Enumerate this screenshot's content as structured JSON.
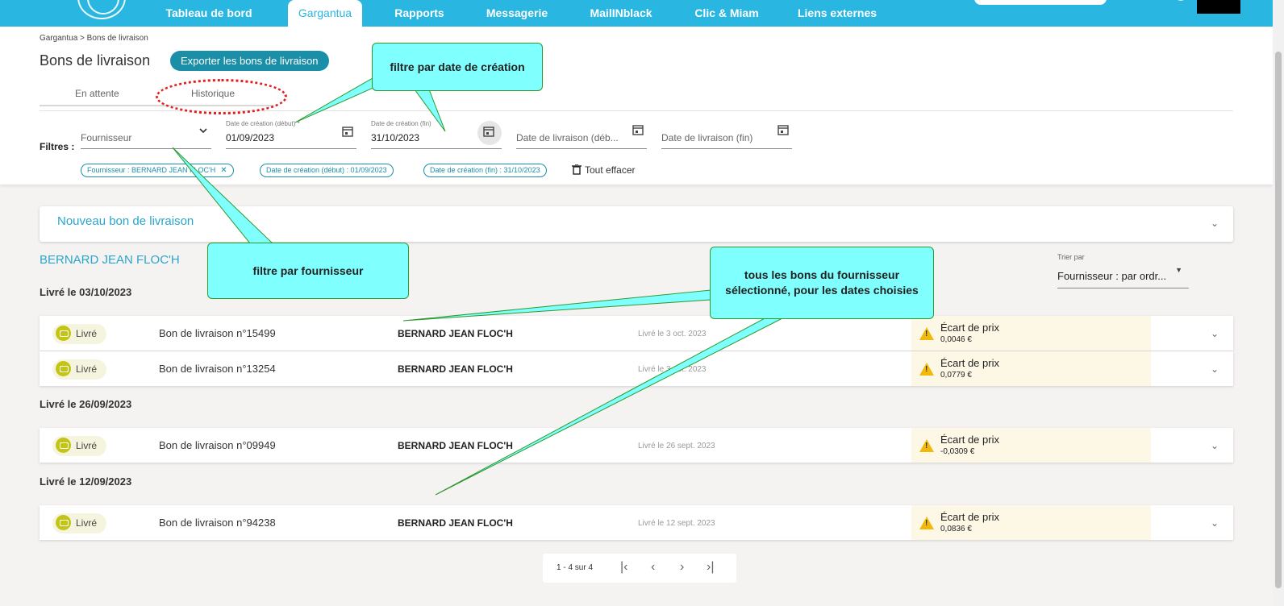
{
  "nav": {
    "items": [
      "Tableau de bord",
      "Gargantua",
      "Rapports",
      "Messagerie",
      "MailINblack",
      "Clic & Miam",
      "Liens externes"
    ],
    "active": "Gargantua"
  },
  "breadcrumb": "Gargantua > Bons de livraison",
  "page_title": "Bons de livraison",
  "export_label": "Exporter les bons de livraison",
  "tabs": [
    "En attente",
    "Historique"
  ],
  "filters": {
    "label": "Filtres :",
    "supplier_placeholder": "Fournisseur",
    "creation_start_label": "Date de création (début) *",
    "creation_start_value": "01/09/2023",
    "creation_end_label": "Date de création (fin)",
    "creation_end_value": "31/10/2023",
    "delivery_start_placeholder": "Date de livraison (déb...",
    "delivery_end_placeholder": "Date de livraison (fin)"
  },
  "chips": [
    "Fournisseur : BERNARD JEAN FLOC'H",
    "Date de création (début) : 01/09/2023",
    "Date de création (fin) : 31/10/2023"
  ],
  "clear_all": "Tout effacer",
  "new_delivery": "Nouveau bon de livraison",
  "supplier_title": "BERNARD JEAN FLOC'H",
  "sort": {
    "label": "Trier par",
    "value": "Fournisseur : par ordr..."
  },
  "groups": [
    {
      "heading": "Livré le 03/10/2023"
    },
    {
      "heading": "Livré le 26/09/2023"
    },
    {
      "heading": "Livré le 12/09/2023"
    }
  ],
  "rows": [
    {
      "status": "Livré",
      "number": "Bon de livraison n°15499",
      "supplier": "BERNARD JEAN FLOC'H",
      "date": "Livré le 3 oct. 2023",
      "gap_title": "Écart de prix",
      "gap_value": "0,0046 €"
    },
    {
      "status": "Livré",
      "number": "Bon de livraison n°13254",
      "supplier": "BERNARD JEAN FLOC'H",
      "date": "Livré le 3 oct. 2023",
      "gap_title": "Écart de prix",
      "gap_value": "0,0779 €"
    },
    {
      "status": "Livré",
      "number": "Bon de livraison n°09949",
      "supplier": "BERNARD JEAN FLOC'H",
      "date": "Livré le 26 sept. 2023",
      "gap_title": "Écart de prix",
      "gap_value": "-0,0309 €"
    },
    {
      "status": "Livré",
      "number": "Bon de livraison n°94238",
      "supplier": "BERNARD JEAN FLOC'H",
      "date": "Livré le 12 sept. 2023",
      "gap_title": "Écart de prix",
      "gap_value": "0,0836 €"
    }
  ],
  "pager": {
    "info": "1 - 4 sur 4"
  },
  "callouts": {
    "date_filter": "filtre par date de création",
    "supplier_filter": "filtre par fournisseur",
    "all_bons": "tous les bons du fournisseur sélectionné, pour les dates choisies"
  },
  "colors": {
    "accent": "#29b6e0",
    "button": "#1a8fa7",
    "callout": "#80ffff",
    "warning": "#f2b90c"
  }
}
